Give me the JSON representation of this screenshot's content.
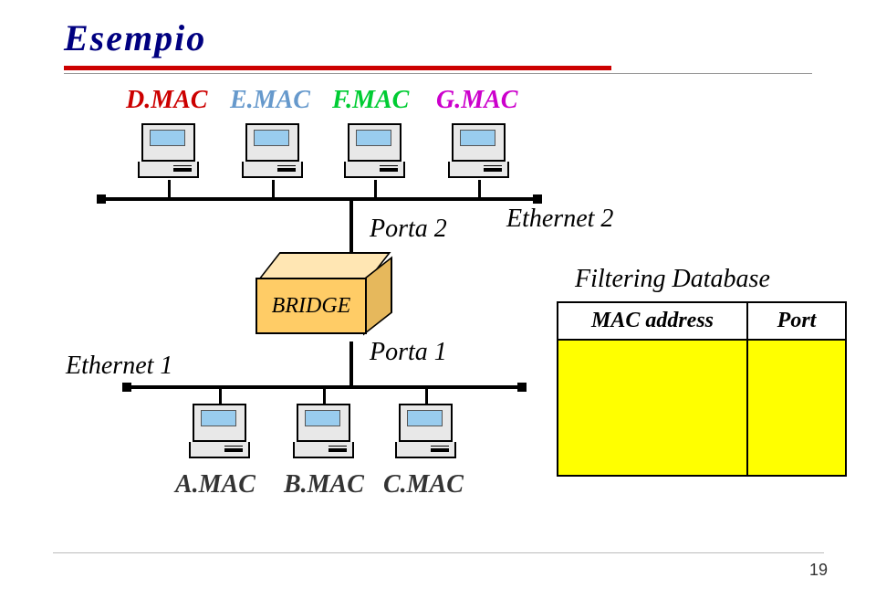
{
  "title": "Esempio",
  "top_macs": {
    "d": "D.MAC",
    "e": "E.MAC",
    "f": "F.MAC",
    "g": "G.MAC"
  },
  "bottom_macs": {
    "a": "A.MAC",
    "b": "B.MAC",
    "c": "C.MAC"
  },
  "labels": {
    "porta2": "Porta 2",
    "porta1": "Porta 1",
    "ethernet1": "Ethernet 1",
    "ethernet2": "Ethernet 2",
    "bridge": "BRIDGE",
    "filtering": "Filtering Database"
  },
  "table": {
    "header_mac": "MAC address",
    "header_port": "Port",
    "rows": []
  },
  "page_number": "19"
}
